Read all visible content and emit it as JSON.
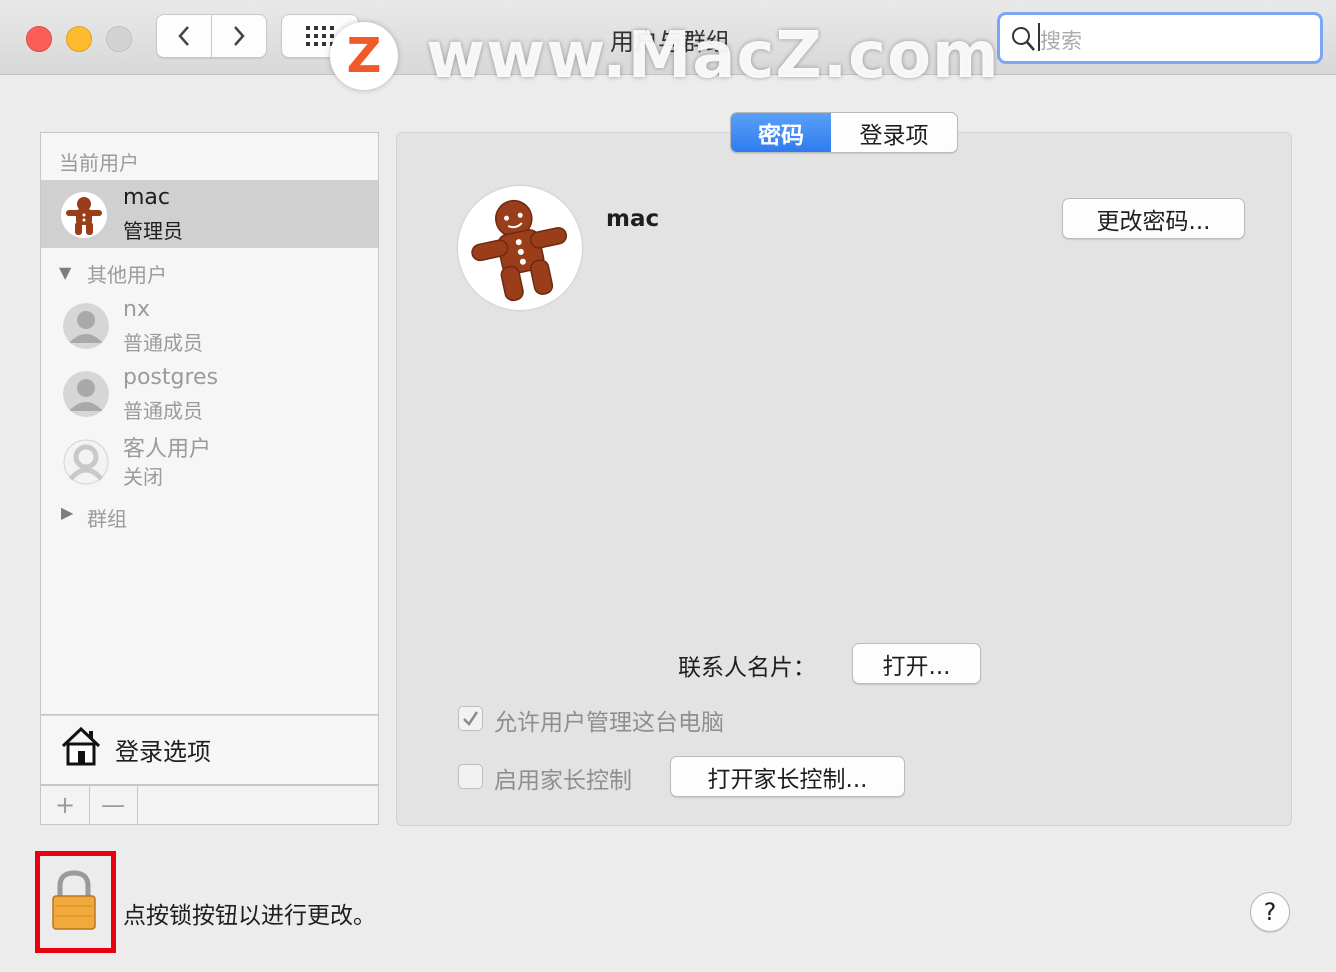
{
  "window": {
    "title": "用户与群组",
    "search_placeholder": "搜索"
  },
  "watermark": {
    "logo_letter": "Z",
    "text": "www.MacZ.com"
  },
  "sidebar": {
    "current_users_header": "当前用户",
    "current_user": {
      "name": "mac",
      "role": "管理员"
    },
    "other_users_header": "其他用户",
    "other_users": [
      {
        "name": "nx",
        "role": "普通成员"
      },
      {
        "name": "postgres",
        "role": "普通成员"
      },
      {
        "name": "客人用户",
        "role": "关闭"
      }
    ],
    "groups_header": "群组",
    "login_options_label": "登录选项",
    "add_symbol": "+",
    "remove_symbol": "—"
  },
  "tabs": [
    {
      "label": "密码",
      "selected": true
    },
    {
      "label": "登录项",
      "selected": false
    }
  ],
  "panel": {
    "user_name": "mac",
    "change_password_button": "更改密码...",
    "contact_card_label": "联系人名片：",
    "open_button": "打开...",
    "allow_admin_label": "允许用户管理这台电脑",
    "allow_admin_checked": true,
    "parental_controls_label": "启用家长控制",
    "parental_controls_checked": false,
    "open_parental_controls_button": "打开家长控制..."
  },
  "footer": {
    "lock_text": "点按锁按钮以进行更改。",
    "help_label": "?"
  },
  "colors": {
    "selected_tab": "#2f7cf0",
    "lock_highlight": "#e60012",
    "search_focus": "#7aa6f2"
  }
}
